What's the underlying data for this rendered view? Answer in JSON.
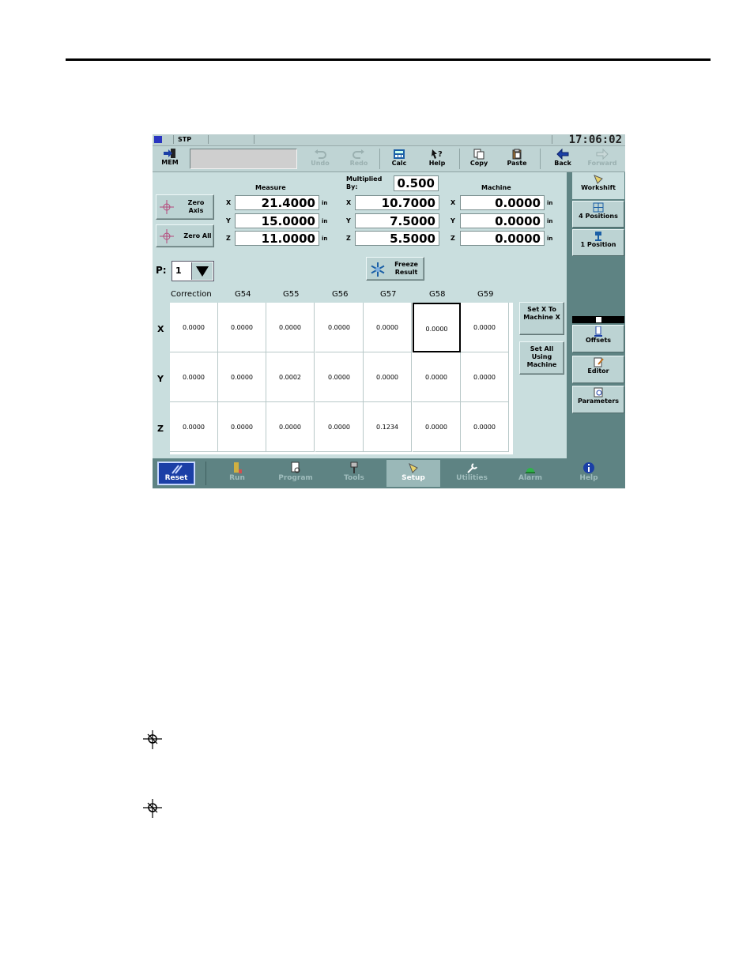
{
  "status_bar": {
    "mode": "STP",
    "clock": "17:06:02"
  },
  "toolbar": {
    "mem_label": "MEM",
    "undo": "Undo",
    "redo": "Redo",
    "calc": "Calc",
    "help": "Help",
    "copy": "Copy",
    "paste": "Paste",
    "back": "Back",
    "forward": "Forward"
  },
  "measure": {
    "heading": "Measure",
    "zero_axis": "Zero Axis",
    "zero_all": "Zero All",
    "unit": "in",
    "axes": [
      "X",
      "Y",
      "Z"
    ],
    "values": [
      "21.4000",
      "15.0000",
      "11.0000"
    ]
  },
  "multiplied": {
    "label": "Multiplied By:",
    "factor": "0.500",
    "values": [
      "10.7000",
      "7.5000",
      "5.5000"
    ]
  },
  "machine": {
    "heading": "Machine",
    "values": [
      "0.0000",
      "0.0000",
      "0.0000"
    ]
  },
  "freeze_result": "Freeze Result",
  "p_selector": {
    "label": "P:",
    "value": "1"
  },
  "grid": {
    "headers": [
      "Correction",
      "G54",
      "G55",
      "G56",
      "G57",
      "G58",
      "G59"
    ],
    "rows": [
      {
        "axis": "X",
        "cells": [
          "0.0000",
          "0.0000",
          "0.0000",
          "0.0000",
          "0.0000",
          "0.0000",
          "0.0000"
        ]
      },
      {
        "axis": "Y",
        "cells": [
          "0.0000",
          "0.0000",
          "0.0002",
          "0.0000",
          "0.0000",
          "0.0000",
          "0.0000"
        ]
      },
      {
        "axis": "Z",
        "cells": [
          "0.0000",
          "0.0000",
          "0.0000",
          "0.0000",
          "0.1234",
          "0.0000",
          "0.0000"
        ]
      }
    ]
  },
  "actions": {
    "set_x_to_machine": "Set X To Machine X",
    "set_all_using_machine": "Set All Using Machine"
  },
  "sidebar": {
    "workshift": "Workshift",
    "four_positions": "4 Positions",
    "one_position": "1 Position",
    "offsets": "Offsets",
    "editor": "Editor",
    "parameters": "Parameters"
  },
  "bottom_nav": {
    "reset": "Reset",
    "run": "Run",
    "program": "Program",
    "tools": "Tools",
    "setup": "Setup",
    "utilities": "Utilities",
    "alarm": "Alarm",
    "help": "Help"
  }
}
